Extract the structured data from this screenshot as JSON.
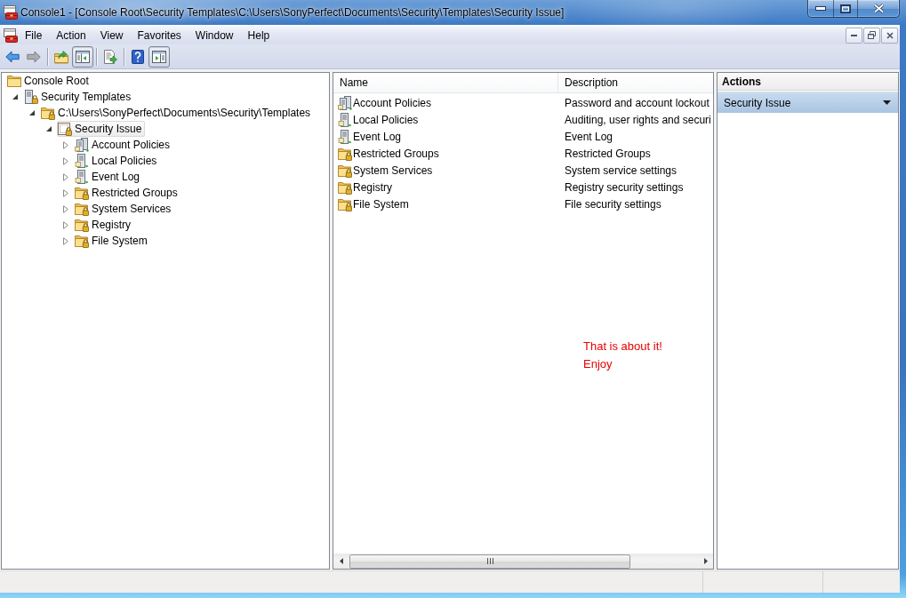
{
  "window": {
    "title": "Console1 - [Console Root\\Security Templates\\C:\\Users\\SonyPerfect\\Documents\\Security\\Templates\\Security Issue]"
  },
  "menu": [
    "File",
    "Action",
    "View",
    "Favorites",
    "Window",
    "Help"
  ],
  "toolbar": [
    {
      "kind": "back",
      "pressed": false,
      "disabled": false
    },
    {
      "kind": "forward",
      "pressed": false,
      "disabled": true
    },
    {
      "kind": "separator"
    },
    {
      "kind": "up-folder",
      "pressed": false,
      "disabled": false
    },
    {
      "kind": "console-tree",
      "pressed": true,
      "disabled": false
    },
    {
      "kind": "separator"
    },
    {
      "kind": "export",
      "pressed": false,
      "disabled": false
    },
    {
      "kind": "separator"
    },
    {
      "kind": "help",
      "pressed": false,
      "disabled": false
    },
    {
      "kind": "action-pane",
      "pressed": true,
      "disabled": false
    }
  ],
  "tree": {
    "label": "Console Root",
    "kind": "folder",
    "selected": false,
    "children": [
      {
        "label": "Security Templates",
        "kind": "server-lock",
        "expanded": true,
        "selected": false,
        "children": [
          {
            "label": "C:\\Users\\SonyPerfect\\Documents\\Security\\Templates",
            "kind": "folder-lock",
            "expanded": true,
            "selected": false,
            "children": [
              {
                "label": "Security Issue",
                "kind": "document-lock",
                "expanded": true,
                "selected": true,
                "children": [
                  {
                    "label": "Account Policies",
                    "kind": "servers",
                    "expanded": false,
                    "selected": false
                  },
                  {
                    "label": "Local Policies",
                    "kind": "server",
                    "expanded": false,
                    "selected": false
                  },
                  {
                    "label": "Event Log",
                    "kind": "server",
                    "expanded": false,
                    "selected": false
                  },
                  {
                    "label": "Restricted Groups",
                    "kind": "folder-lock",
                    "expanded": false,
                    "selected": false
                  },
                  {
                    "label": "System Services",
                    "kind": "folder-lock",
                    "expanded": false,
                    "selected": false
                  },
                  {
                    "label": "Registry",
                    "kind": "folder-lock",
                    "expanded": false,
                    "selected": false
                  },
                  {
                    "label": "File System",
                    "kind": "folder-lock",
                    "expanded": false,
                    "selected": false
                  }
                ]
              }
            ]
          }
        ]
      }
    ]
  },
  "list": {
    "columns": [
      "Name",
      "Description"
    ],
    "rows": [
      {
        "name": "Account Policies",
        "description": "Password and account lockout",
        "kind": "servers"
      },
      {
        "name": "Local Policies",
        "description": "Auditing, user rights and securi",
        "kind": "server"
      },
      {
        "name": "Event Log",
        "description": "Event Log",
        "kind": "server"
      },
      {
        "name": "Restricted Groups",
        "description": "Restricted Groups",
        "kind": "folder-lock"
      },
      {
        "name": "System Services",
        "description": "System service settings",
        "kind": "folder-lock"
      },
      {
        "name": "Registry",
        "description": "Registry security settings",
        "kind": "folder-lock"
      },
      {
        "name": "File System",
        "description": "File security settings",
        "kind": "folder-lock"
      }
    ],
    "annotation": "That is about it!\nEnjoy"
  },
  "actions": {
    "title": "Actions",
    "items": [
      {
        "label": "Security Issue",
        "expanded": true
      }
    ]
  }
}
